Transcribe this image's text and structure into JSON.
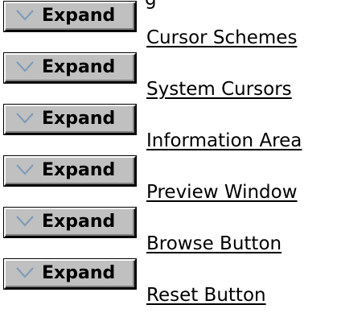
{
  "top_text": "g",
  "expand_label": "Expand",
  "chevron_color": "#7f9db9",
  "rows": [
    {
      "link": "Cursor Schemes"
    },
    {
      "link": "System Cursors"
    },
    {
      "link": "Information Area"
    },
    {
      "link": "Preview Window"
    },
    {
      "link": "Browse Button"
    },
    {
      "link": "Reset Button"
    }
  ]
}
